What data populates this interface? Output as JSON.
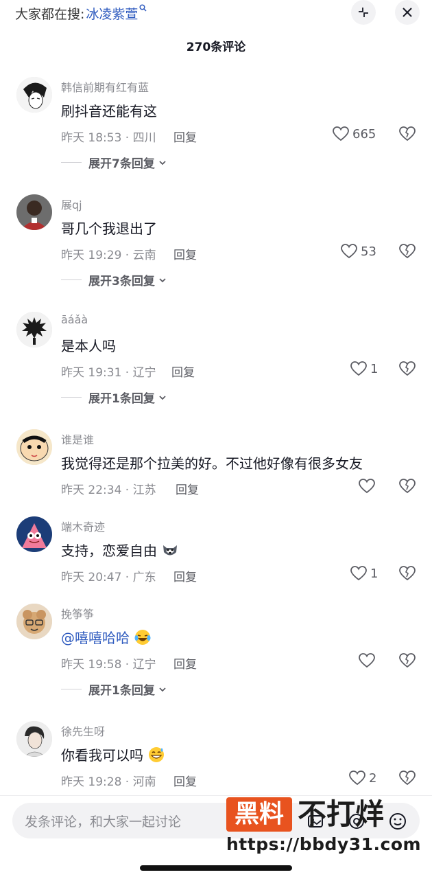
{
  "header": {
    "search_prefix": "大家都在搜:",
    "search_keyword": "冰凌紫萱",
    "collapse_icon": "collapse-icon",
    "close_icon": "close-icon"
  },
  "comment_count_title": "270条评论",
  "comments": [
    {
      "username": "韩信前期有红有蓝",
      "text": "刷抖音还能有这",
      "meta": "昨天 18:53 · 四川",
      "reply": "回复",
      "likes": "665",
      "expand": "展开7条回复"
    },
    {
      "username": "展qj",
      "text": "哥几个我退出了",
      "meta": "昨天 19:29 · 云南",
      "reply": "回复",
      "likes": "53",
      "expand": "展开3条回复"
    },
    {
      "username": "āáǎà",
      "text": "是本人吗",
      "meta": "昨天 19:31 · 辽宁",
      "reply": "回复",
      "likes": "1",
      "expand": "展开1条回复"
    },
    {
      "username": "谁是谁",
      "text": "我觉得还是那个拉美的好。不过他好像有很多女友",
      "meta": "昨天 22:34 · 江苏",
      "reply": "回复",
      "likes": ""
    },
    {
      "username": "端木奇迹",
      "text": "支持，恋爱自由",
      "meta": "昨天 20:47 · 广东",
      "reply": "回复",
      "likes": "1",
      "emoji": "husky-emoji"
    },
    {
      "username": "挽筝筝",
      "mention": "@嘻嘻哈哈",
      "meta": "昨天 19:58 · 辽宁",
      "reply": "回复",
      "likes": "",
      "expand": "展开1条回复",
      "emoji": "laugh-cry-emoji"
    },
    {
      "username": "徐先生呀",
      "text": "你看我可以吗",
      "meta": "昨天 19:28 · 河南",
      "reply": "回复",
      "likes": "2",
      "emoji": "sweat-smile-emoji"
    }
  ],
  "input": {
    "placeholder": "发条评论，和大家一起讨论",
    "icons": [
      "image-icon",
      "at-icon",
      "emoji-icon"
    ]
  },
  "watermark": {
    "box_text": "黑料",
    "title": "不打烊",
    "url": "https://bbdy31.com"
  },
  "colors": {
    "link": "#2f5bbf",
    "secondary_text": "#8a8b91",
    "watermark_orange": "#e8531f"
  }
}
